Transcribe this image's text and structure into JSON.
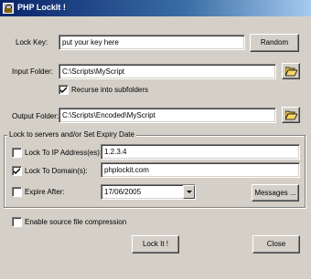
{
  "window": {
    "title": "PHP LockIt !"
  },
  "lock_key": {
    "label": "Lock Key:",
    "value": "put your key here",
    "random_label": "Random"
  },
  "input_folder": {
    "label": "Input Folder:",
    "value": "C:\\Scripts\\MyScript",
    "recurse_label": "Recurse into subfolders",
    "recurse_checked": true
  },
  "output_folder": {
    "label": "Output Folder:",
    "value": "C:\\Scripts\\Encoded\\MyScript"
  },
  "lock_group": {
    "title": "Lock to servers and/or Set Expiry Date",
    "ip": {
      "label": "Lock To IP Address(es):",
      "value": "1.2.3.4",
      "checked": false
    },
    "domain": {
      "label": "Lock To Domain(s):",
      "value": "phplockit.com",
      "checked": true
    },
    "expire": {
      "label": "Expire After:",
      "value": "17/06/2005",
      "checked": false
    },
    "messages_label": "Messages ..."
  },
  "compression": {
    "label": "Enable source file compression",
    "checked": false
  },
  "actions": {
    "lock_label": "Lock It !",
    "close_label": "Close"
  },
  "icons": {
    "app": "padlock-icon",
    "folder": "open-folder-icon",
    "check": "checkmark-icon",
    "dropdown": "chevron-down-icon"
  }
}
